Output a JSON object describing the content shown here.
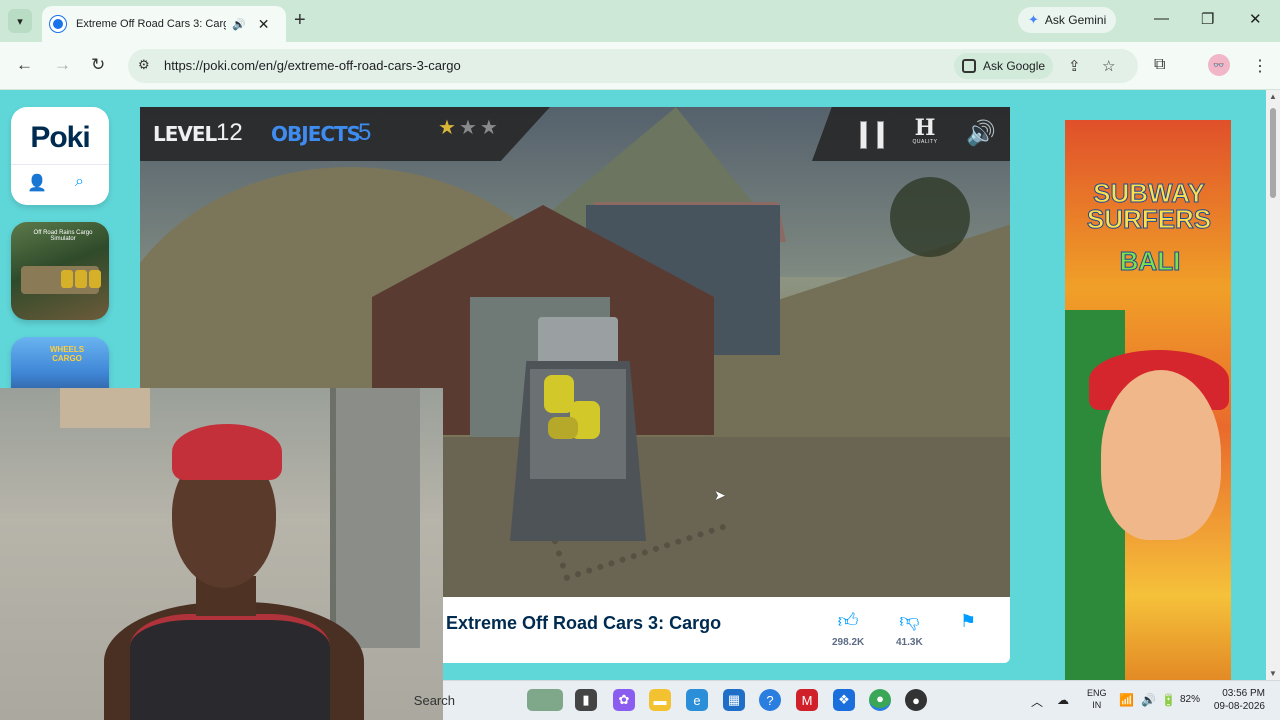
{
  "browser": {
    "tab_title": "Extreme Off Road Cars 3: Cargo",
    "ask_gemini": "Ask Gemini",
    "url": "https://poki.com/en/g/extreme-off-road-cars-3-cargo",
    "ask_google": "Ask Google",
    "profile_initials": "👓"
  },
  "sidebar": {
    "logo": "Poki",
    "thumb1_caption": "Off Road Rains Cargo Simulator",
    "thumb2_caption": "WHEELS CARGO"
  },
  "game": {
    "level_label": "LEVEL",
    "level_value": "12",
    "objects_label": "OBJECTS",
    "objects_value": "5",
    "stars_earned": 1,
    "stars_total": 3,
    "quality_label": "QUALITY",
    "quality_letter": "H"
  },
  "info_bar": {
    "title": "Extreme Off Road Cars 3: Cargo",
    "likes": "298.2K",
    "dislikes": "41.3K"
  },
  "ad": {
    "line1": "SUBWAY SURFERS",
    "line2": "BALI"
  },
  "taskbar": {
    "search": "Search",
    "lang_top": "ENG",
    "lang_bottom": "IN",
    "battery": "82%",
    "time": "03:56 PM",
    "date": "09-08-2026"
  },
  "colors": {
    "page_bg": "#5fd6d8",
    "poki_blue": "#009cff",
    "objects_blue": "#3f8cf0",
    "star_gold": "#d9b53a"
  }
}
